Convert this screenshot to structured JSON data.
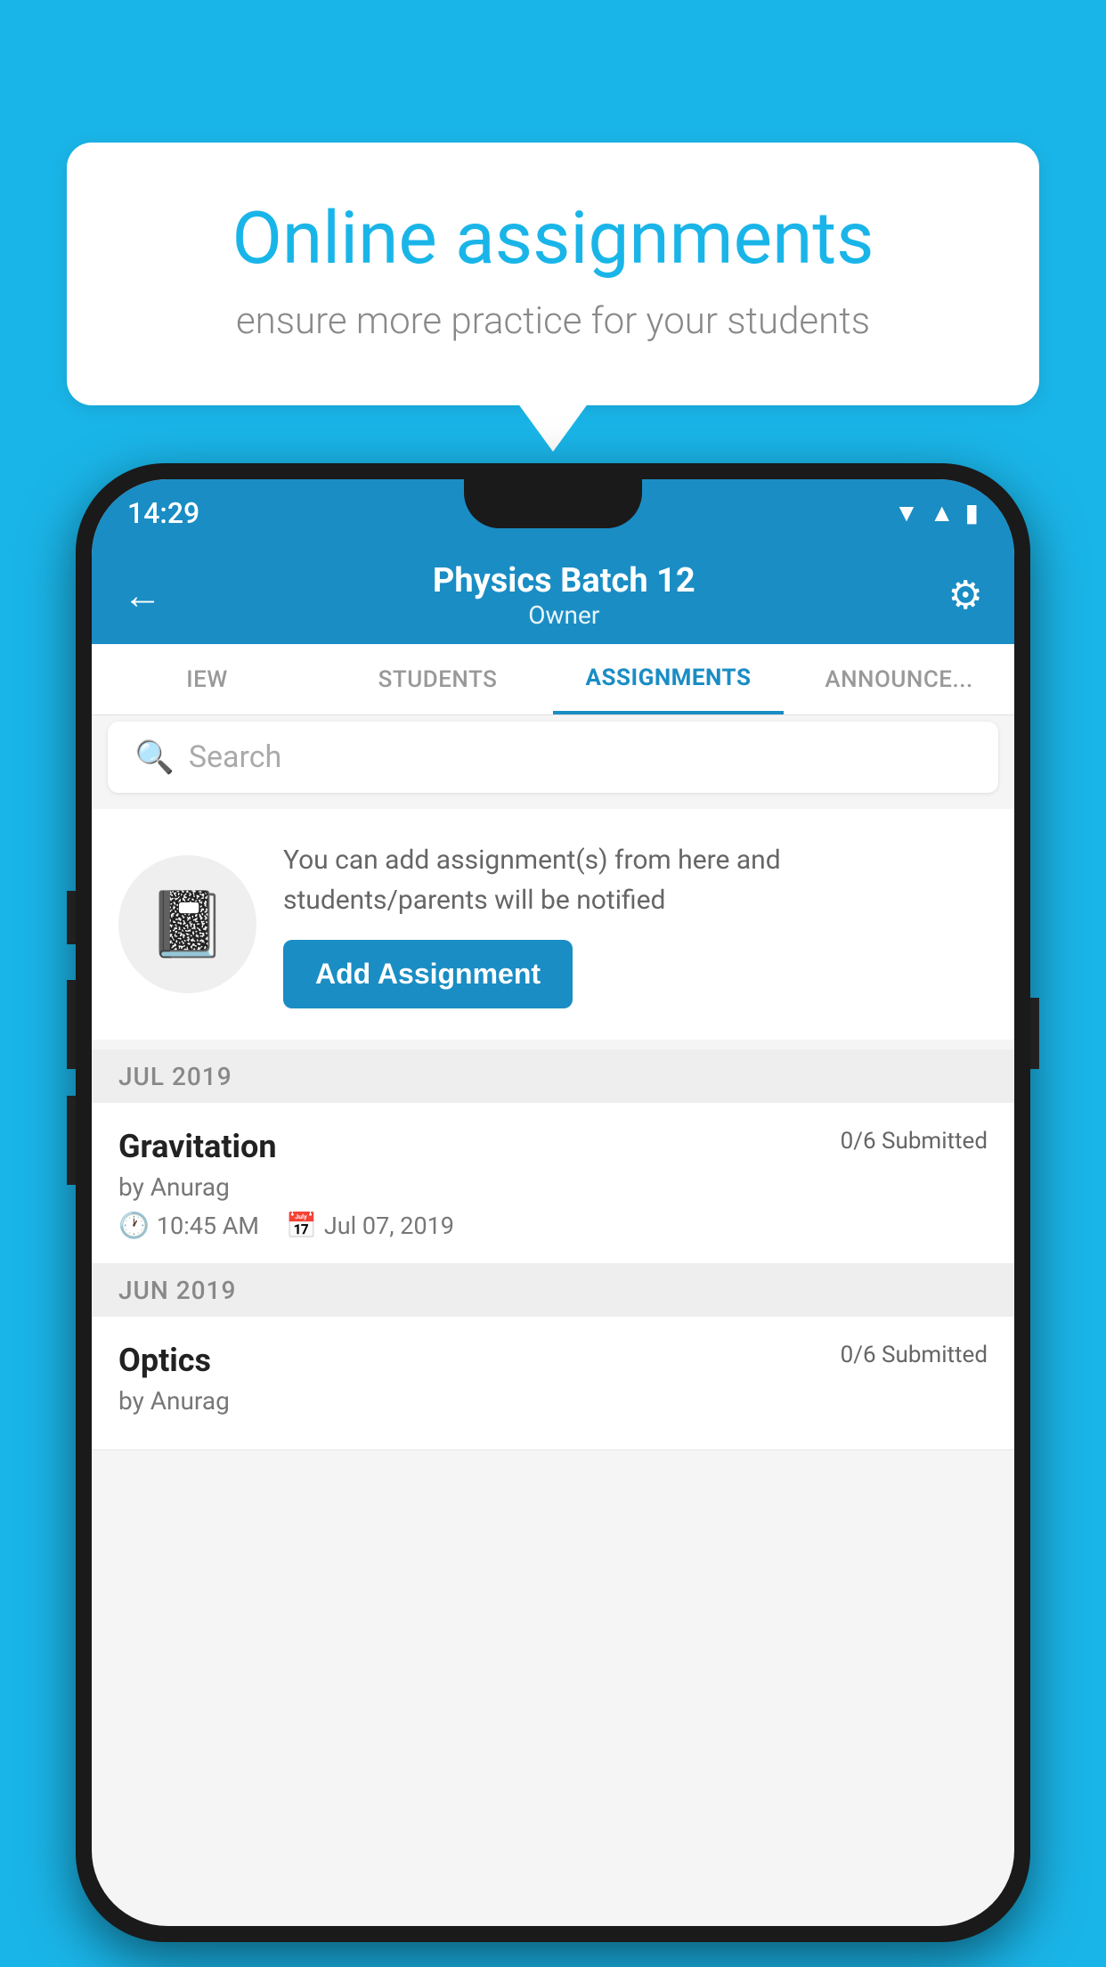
{
  "bubble": {
    "title": "Online assignments",
    "subtitle": "ensure more practice for your students"
  },
  "status_bar": {
    "time": "14:29",
    "icons": [
      "wifi",
      "signal",
      "battery"
    ]
  },
  "header": {
    "title": "Physics Batch 12",
    "subtitle": "Owner",
    "back_label": "←",
    "settings_label": "⚙"
  },
  "tabs": [
    {
      "label": "IEW",
      "active": false
    },
    {
      "label": "STUDENTS",
      "active": false
    },
    {
      "label": "ASSIGNMENTS",
      "active": true
    },
    {
      "label": "ANNOUNCEMENTS",
      "active": false
    }
  ],
  "search": {
    "placeholder": "Search"
  },
  "info_card": {
    "text": "You can add assignment(s) from here and students/parents will be notified",
    "button_label": "Add Assignment"
  },
  "sections": [
    {
      "month": "JUL 2019",
      "assignments": [
        {
          "title": "Gravitation",
          "submitted": "0/6 Submitted",
          "author": "by Anurag",
          "time": "10:45 AM",
          "date": "Jul 07, 2019"
        }
      ]
    },
    {
      "month": "JUN 2019",
      "assignments": [
        {
          "title": "Optics",
          "submitted": "0/6 Submitted",
          "author": "by Anurag",
          "time": "",
          "date": ""
        }
      ]
    }
  ],
  "colors": {
    "background": "#1ab5e8",
    "header_bg": "#1a8dc4",
    "accent": "#1a8dc4"
  }
}
